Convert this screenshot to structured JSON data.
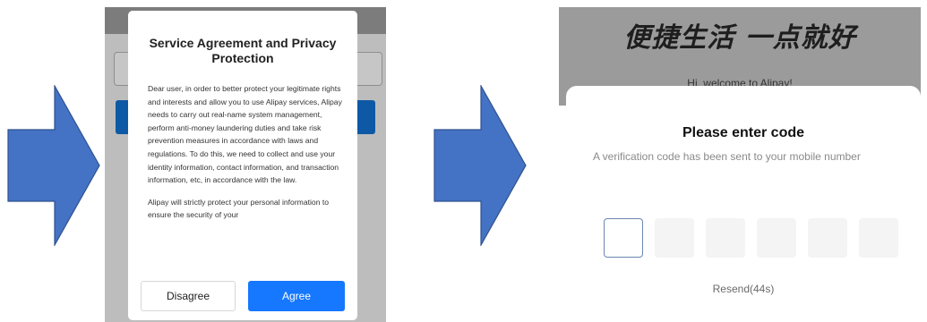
{
  "colors": {
    "arrow": "#4472c4",
    "agree_button": "#1677ff",
    "overlay": "#7c7c7c"
  },
  "step1": {
    "dialog": {
      "title": "Service Agreement and Privacy Protection",
      "paragraph1": "Dear user, in order to better protect your legitimate rights and interests and allow you to use Alipay services, Alipay needs to carry out real-name system management, perform anti-money laundering duties and take risk prevention measures in accordance with laws and regulations. To do this, we need to collect and use your identity information, contact information, and transaction information, etc, in accordance with the law.",
      "paragraph2": "Alipay will strictly protect your personal information to ensure the security of your",
      "disagree_label": "Disagree",
      "agree_label": "Agree"
    }
  },
  "step2": {
    "slogan": "便捷生活 一点就好",
    "welcome": "Hi, welcome to Alipay!",
    "sheet_title": "Please enter code",
    "sheet_subtitle": "A verification code has been sent to your mobile number",
    "code_boxes": [
      "",
      "",
      "",
      "",
      "",
      ""
    ],
    "resend_label": "Resend(44s)"
  },
  "arrows": [
    "right-arrow-icon",
    "right-arrow-icon"
  ]
}
